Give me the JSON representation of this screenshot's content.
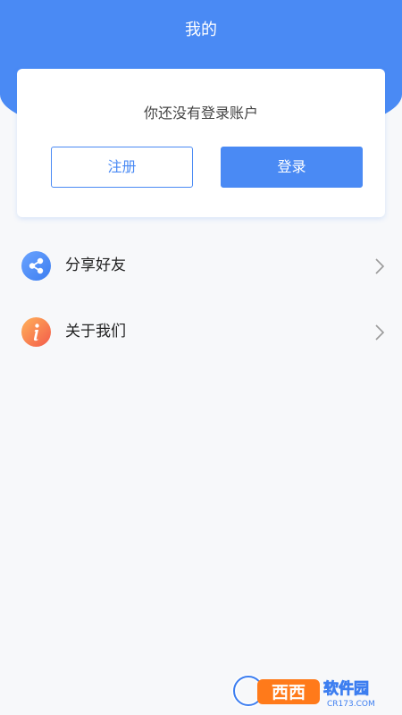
{
  "header": {
    "title": "我的",
    "accent_color": "#4a8af4"
  },
  "login_card": {
    "prompt": "你还没有登录账户",
    "register_label": "注册",
    "login_label": "登录"
  },
  "menu": [
    {
      "label": "分享好友",
      "icon": "share-icon",
      "icon_color": "#4a8af4"
    },
    {
      "label": "关于我们",
      "icon": "info-icon",
      "icon_color": "#f3674a"
    }
  ],
  "watermark": {
    "logo_text": "西西软件园",
    "site_text": "CR173.COM"
  }
}
